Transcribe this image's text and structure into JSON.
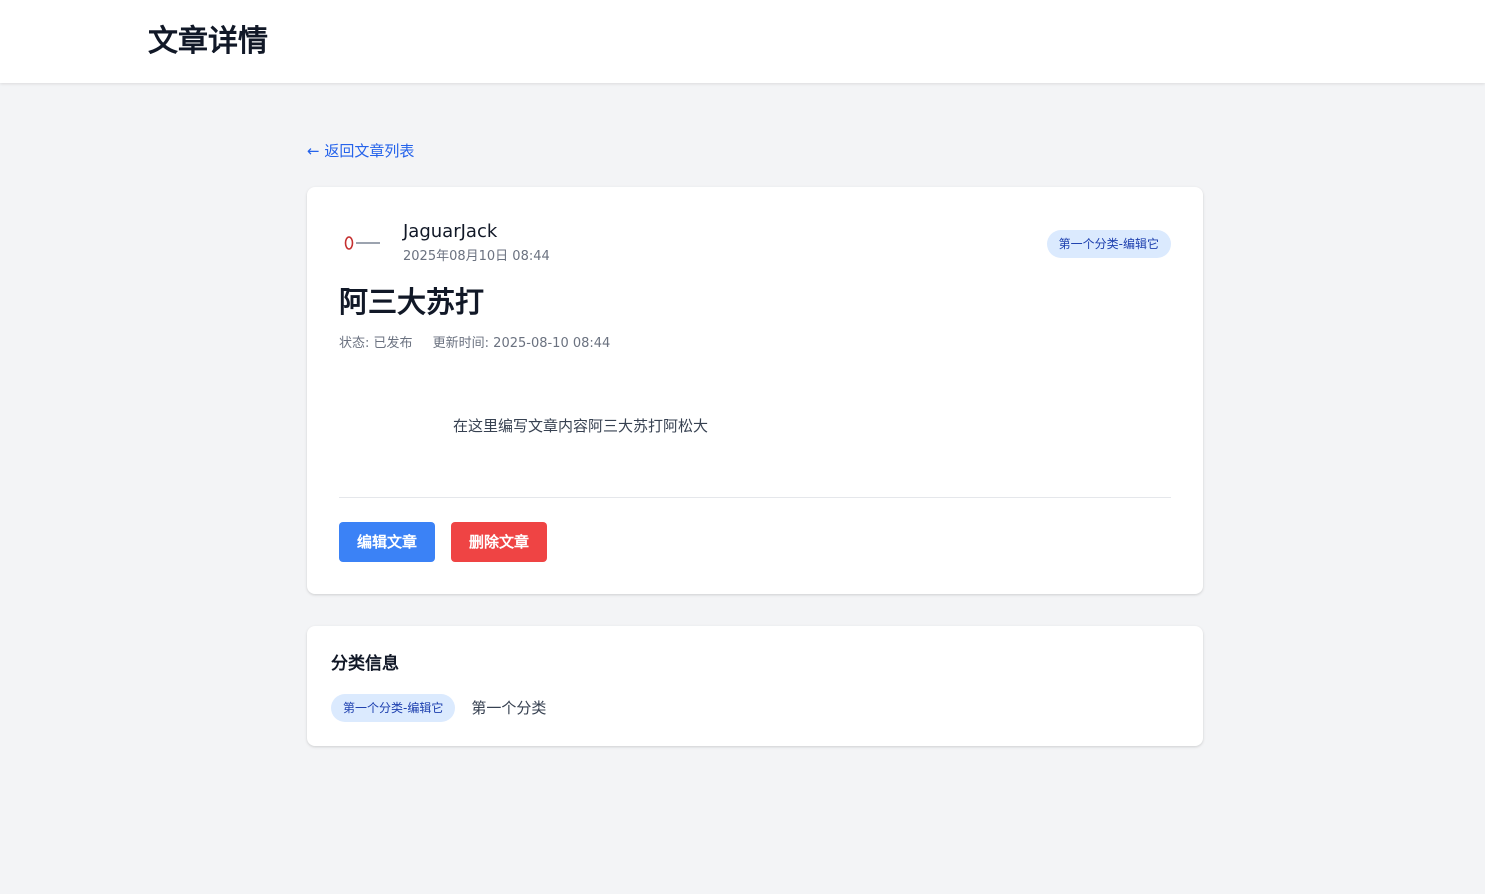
{
  "header": {
    "title": "文章详情"
  },
  "nav": {
    "back_label": "← 返回文章列表"
  },
  "article": {
    "author": "JaguarJack",
    "date": "2025年08月10日 08:44",
    "category_badge": "第一个分类-编辑它",
    "title": "阿三大苏打",
    "status": "状态: 已发布",
    "updated": "更新时间: 2025-08-10 08:44",
    "content": "在这里编写文章内容阿三大苏打阿松大",
    "edit_label": "编辑文章",
    "delete_label": "删除文章"
  },
  "category_info": {
    "heading": "分类信息",
    "badge": "第一个分类-编辑它",
    "name": "第一个分类"
  },
  "colors": {
    "accent": "#3b82f6",
    "danger": "#ef4444",
    "badge_bg": "#dbeafe",
    "badge_text": "#1e40af",
    "link": "#2563eb"
  },
  "icons": {
    "avatar": "author-avatar-image"
  }
}
